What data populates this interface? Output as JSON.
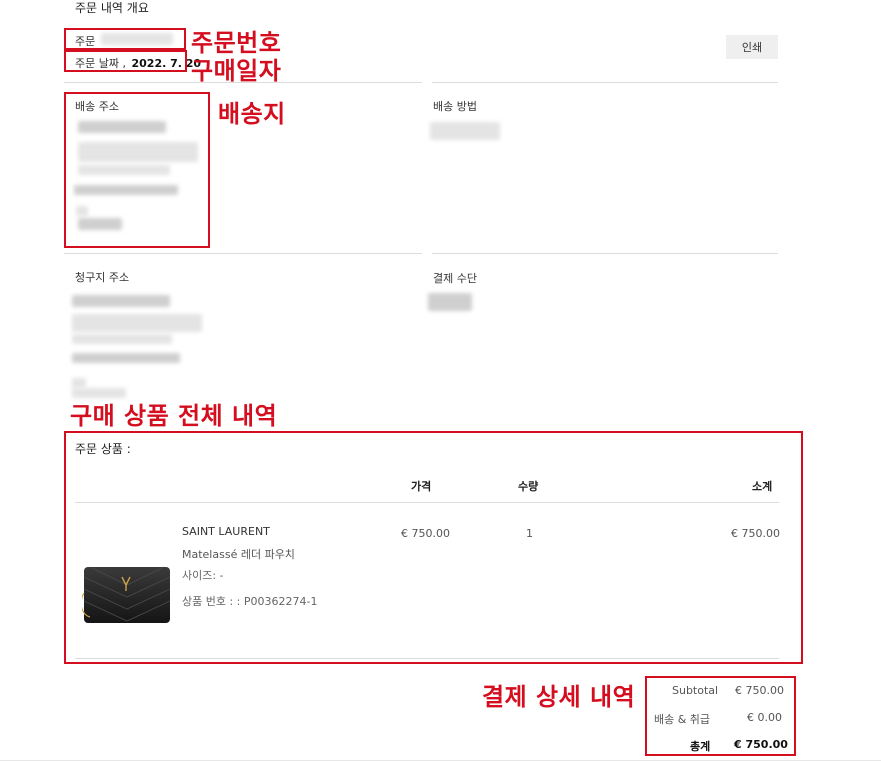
{
  "header": {
    "title": "주문 내역 개요",
    "order_label": "주문",
    "date_label": "주문 날짜 ,",
    "date_value": "2022. 7. 20",
    "print_label": "인쇄"
  },
  "annotations": {
    "order_number": "주문번호",
    "purchase_date": "구매일자",
    "shipping_dest": "배송지",
    "all_items": "구매 상품 전체 내역",
    "payment_detail": "결제 상세 내역"
  },
  "sections": {
    "shipping_address": "배송 주소",
    "shipping_method": "배송 방법",
    "billing_address": "청구지 주소",
    "payment_method": "결제 수단"
  },
  "items_section": {
    "title": "주문 상품 :",
    "columns": {
      "price": "가격",
      "qty": "수량",
      "subtotal": "소계"
    },
    "items": [
      {
        "brand": "SAINT LAURENT",
        "name": "Matelassé 레더 파우치",
        "size": "사이즈: -",
        "product_no": "상품 번호 : : P00362274-1",
        "price": "€ 750.00",
        "qty": "1",
        "subtotal": "€ 750.00"
      }
    ]
  },
  "totals": {
    "subtotal_label": "Subtotal",
    "subtotal_value": "€ 750.00",
    "shipping_label": "배송 & 취급",
    "shipping_value": "€ 0.00",
    "total_label": "총계",
    "total_value": "€ 750.00"
  },
  "colors": {
    "annotation_red": "#d40e1f",
    "divider": "#dcdcdc"
  },
  "icons": {
    "product_image": "black-leather-pouch"
  }
}
